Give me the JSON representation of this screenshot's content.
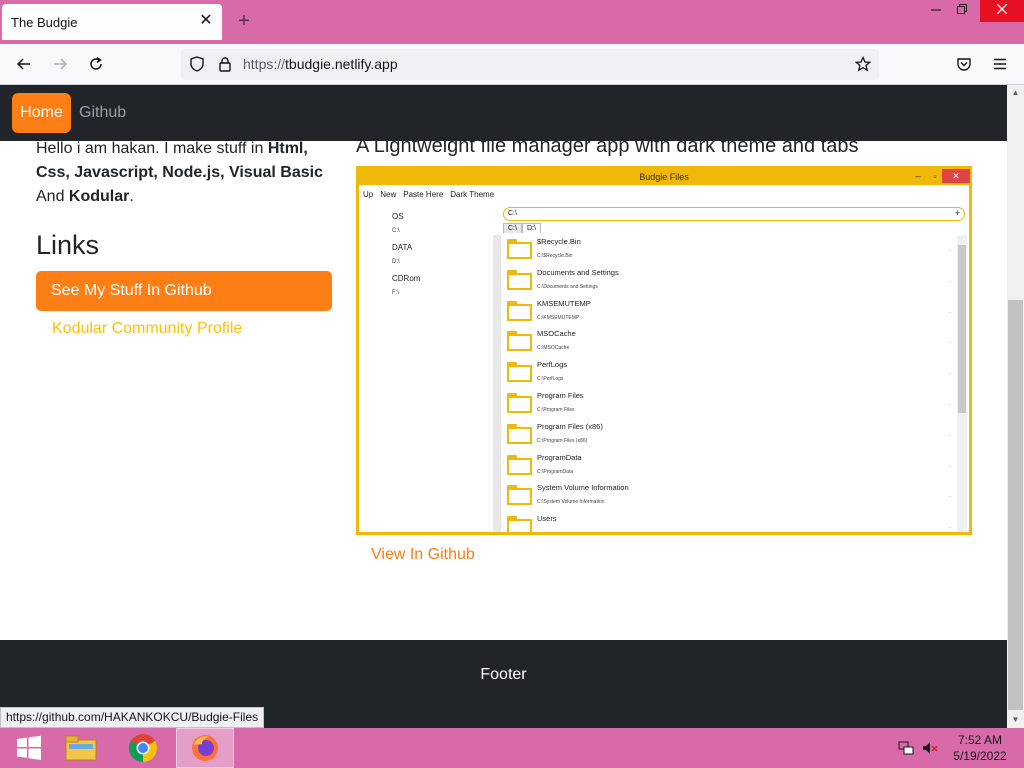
{
  "browser": {
    "tab_title": "The Budgie",
    "tab_close": "✕",
    "new_tab": "+",
    "url_protocol": "https://",
    "url_host": "tbudgie.netlify.app"
  },
  "site_nav": {
    "home": "Home",
    "github": "Github"
  },
  "intro": {
    "line_pre": "Hello i am hakan. I make stuff in ",
    "skills": "Html, Css, Javascript, Node.js, Visual Basic",
    "and": " And ",
    "kodular": "Kodular",
    "period": "."
  },
  "links": {
    "title": "Links",
    "github_button": "See My Stuff In Github",
    "kodular_link": "Kodular Community Profile"
  },
  "project": {
    "title": "A Lightweight file manager app with dark theme and tabs",
    "view_link": "View In Github",
    "app": {
      "window_title": "Budgie Files",
      "menu": [
        "Up",
        "New",
        "Paste Here",
        "Dark Theme"
      ],
      "drives": [
        {
          "label": "OS",
          "path": "C:\\"
        },
        {
          "label": "DATA",
          "path": "D:\\"
        },
        {
          "label": "CDRom",
          "path": "F:\\"
        }
      ],
      "path_value": "C:\\",
      "path_plus": "+",
      "tabs": [
        "C:\\",
        "D:\\"
      ],
      "files": [
        {
          "name": "$Recycle.Bin",
          "path": "C:\\$Recycle.Bin"
        },
        {
          "name": "Documents and Settings",
          "path": "C:\\Documents and Settings"
        },
        {
          "name": "KMSEMUTEMP",
          "path": "C:\\KMSEMUTEMP"
        },
        {
          "name": "MSOCache",
          "path": "C:\\MSOCache"
        },
        {
          "name": "PerfLogs",
          "path": "C:\\PerfLogs"
        },
        {
          "name": "Program Files",
          "path": "C:\\Program Files"
        },
        {
          "name": "Program Files (x86)",
          "path": "C:\\Program Files (x86)"
        },
        {
          "name": "ProgramData",
          "path": "C:\\ProgramData"
        },
        {
          "name": "System Volume Information",
          "path": "C:\\System Volume Information"
        },
        {
          "name": "Users",
          "path": ""
        }
      ]
    }
  },
  "footer": {
    "text": "Footer"
  },
  "status_bar": {
    "link_url": "https://github.com/HAKANKOKCU/Budgie-Files"
  },
  "taskbar": {
    "time": "7:52 AM",
    "date": "5/19/2022"
  },
  "colors": {
    "accent_orange": "#fd7e14",
    "accent_yellow": "#ffc107",
    "dark": "#212529",
    "chrome_pink": "#d86aa9"
  }
}
